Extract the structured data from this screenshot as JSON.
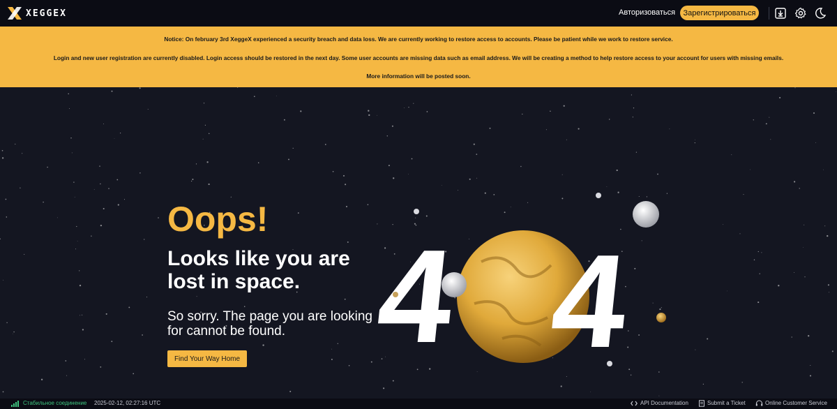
{
  "header": {
    "logo_text": "XEGGEX",
    "login_label": "Авторизоваться",
    "register_label": "Зарегистрироваться",
    "icons": [
      "download-icon",
      "gear-icon",
      "moon-icon"
    ]
  },
  "notice": {
    "line1": "Notice: On february 3rd XeggeX experienced a security breach and data loss. We are currently working to restore access to accounts. Please be patient while we work to restore service.",
    "line2": "Login and new user registration are currently disabled. Login access should be restored in the next day. Some user accounts are missing data such as email address. We will be creating a method to help restore access to your account for users with missing emails.",
    "line3": "More information will be posted soon."
  },
  "main": {
    "oops": "Oops!",
    "headline": "Looks like you are lost in space.",
    "sorry": "So sorry. The page you are looking for cannot be found.",
    "home_button": "Find Your Way Home",
    "illustration": {
      "digit_left": "4",
      "digit_right": "4"
    }
  },
  "footer": {
    "status": "Стабильное соединение",
    "timestamp": "2025-02-12, 02:27:16 UTC",
    "api_docs": "API Documentation",
    "ticket": "Submit a Ticket",
    "support": "Online Customer Service"
  },
  "colors": {
    "accent": "#f5b843",
    "background": "#141621",
    "topbar": "#0b0c14",
    "status": "#3ec47f"
  }
}
